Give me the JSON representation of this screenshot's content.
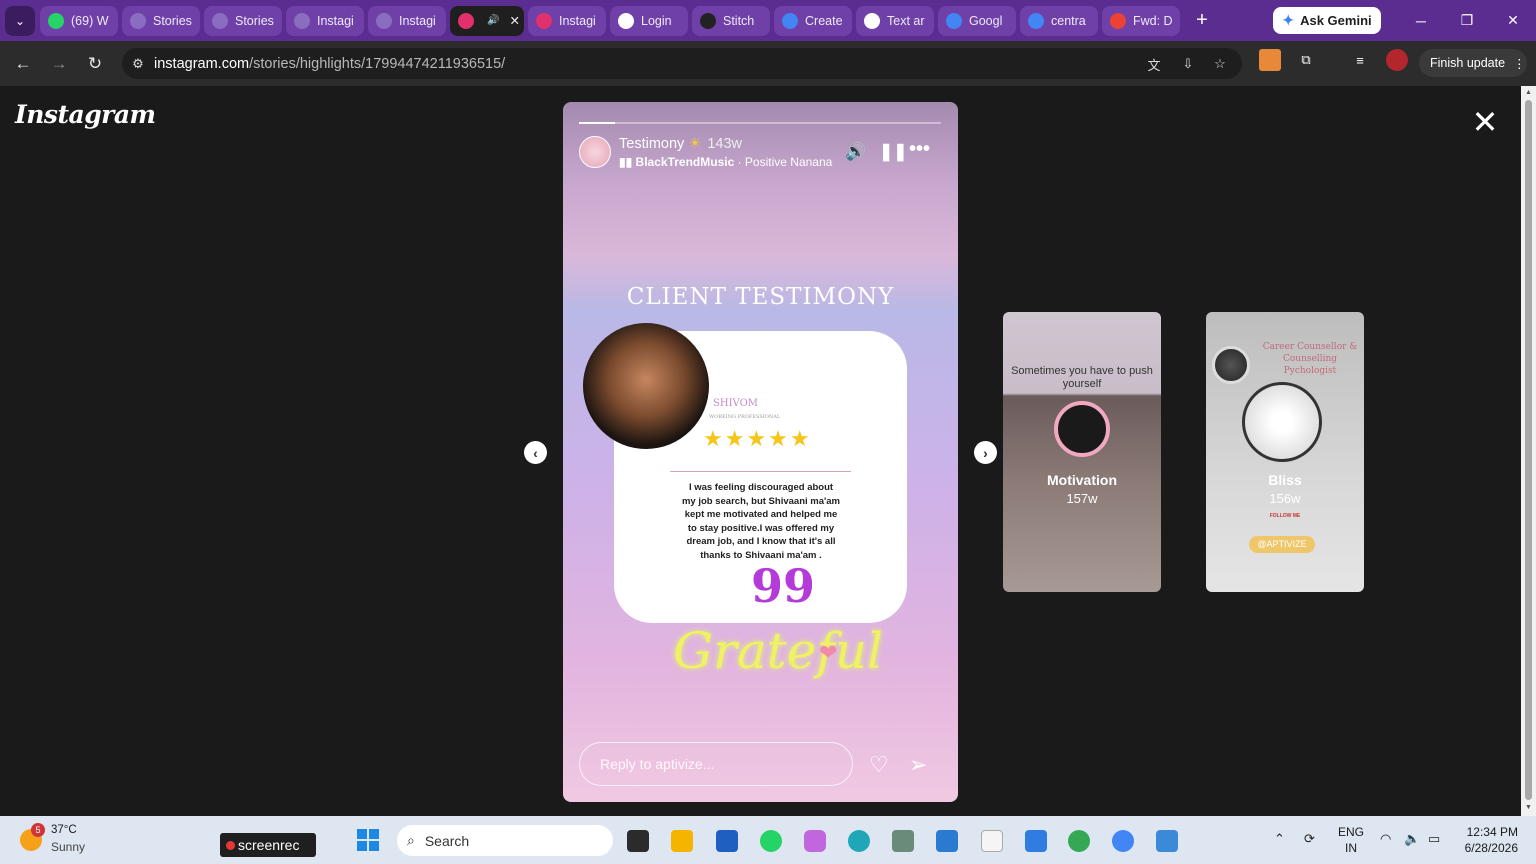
{
  "browser": {
    "tabs": [
      {
        "label": "(69) W",
        "icon": "whatsapp-icon",
        "color": "#25d366"
      },
      {
        "label": "Stories",
        "icon": "globe-icon",
        "color": "#8a6cc0"
      },
      {
        "label": "Stories",
        "icon": "globe-icon",
        "color": "#8a6cc0"
      },
      {
        "label": "Instagi",
        "icon": "globe-icon",
        "color": "#8a6cc0"
      },
      {
        "label": "Instagi",
        "icon": "globe-icon",
        "color": "#8a6cc0"
      },
      {
        "label": "",
        "icon": "instagram-icon",
        "color": "#e1306c",
        "active": true
      },
      {
        "label": "Instagi",
        "icon": "instagram-icon",
        "color": "#e1306c"
      },
      {
        "label": "Login",
        "icon": "openai-icon",
        "color": "#ffffff"
      },
      {
        "label": "Stitch",
        "icon": "stitch-icon",
        "color": "#222222"
      },
      {
        "label": "Create",
        "icon": "google-icon",
        "color": "#4285f4"
      },
      {
        "label": "Text ar",
        "icon": "openai-icon",
        "color": "#ffffff"
      },
      {
        "label": "Googl",
        "icon": "translate-icon",
        "color": "#4285f4"
      },
      {
        "label": "centra",
        "icon": "google-icon",
        "color": "#4285f4"
      },
      {
        "label": "Fwd: D",
        "icon": "gmail-icon",
        "color": "#ea4335"
      }
    ],
    "gemini_label": "Ask Gemini",
    "url_host": "instagram.com",
    "url_path": "/stories/highlights/17994474211936515/",
    "finish_update": "Finish update"
  },
  "instagram": {
    "logo": "Instagram",
    "story": {
      "username": "Testimony",
      "sun": "☀",
      "time": "143w",
      "music_artist": "BlackTrendMusic",
      "music_sep": " · ",
      "music_song": "Positive Nanana",
      "progress": 0.1,
      "title": "CLIENT TESTIMONY",
      "client_name": "SHIVOM",
      "client_role": "WORKING PROFESSIONAL",
      "stars": "★★★★★",
      "quote": "I was feeling discouraged about my job search, but Shivaani ma'am kept me motivated and helped me to stay positive.I was offered my dream job, and I know that it's all thanks to Shivaani ma'am .",
      "quote_mark": "99",
      "grateful": "Grateful",
      "reply_placeholder": "Reply to aptivize..."
    },
    "previews": [
      {
        "caption": "Sometimes you have to push yourself",
        "label": "Motivation",
        "time": "157w"
      },
      {
        "header": "Career Counsellor & Counselling Pychologist",
        "label": "Bliss",
        "time": "156w",
        "follow": "FOLLOW ME",
        "handle": "@APTIVIZE"
      }
    ]
  },
  "taskbar": {
    "weather_badge": "5",
    "temp": "37°C",
    "condition": "Sunny",
    "screenrec": "screenrec",
    "search": "Search",
    "lang1": "ENG",
    "lang2": "IN",
    "time": "12:34 PM",
    "date": "6/28/2026"
  }
}
